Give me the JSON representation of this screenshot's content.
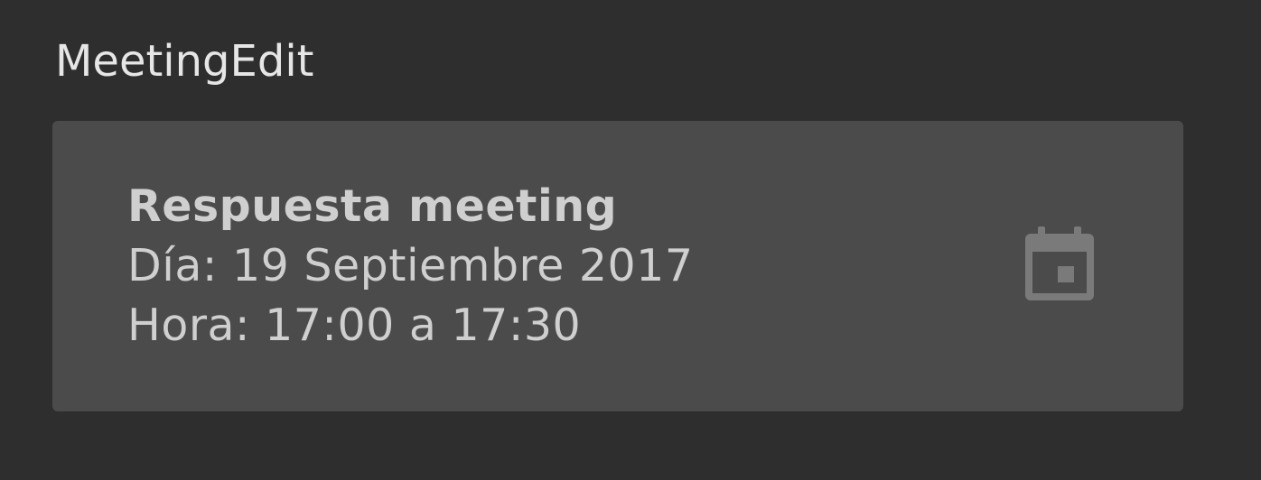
{
  "widget": {
    "title": "MeetingEdit"
  },
  "meeting_card": {
    "subject": "Respuesta meeting",
    "day_line": "Día: 19 Septiembre 2017",
    "time_line": "Hora: 17:00 a 17:30",
    "icon": "calendar-icon"
  },
  "colors": {
    "background": "#2e2e2e",
    "card": "#4b4b4b",
    "text": "#cfcfcf",
    "icon": "#7a7a7a"
  }
}
